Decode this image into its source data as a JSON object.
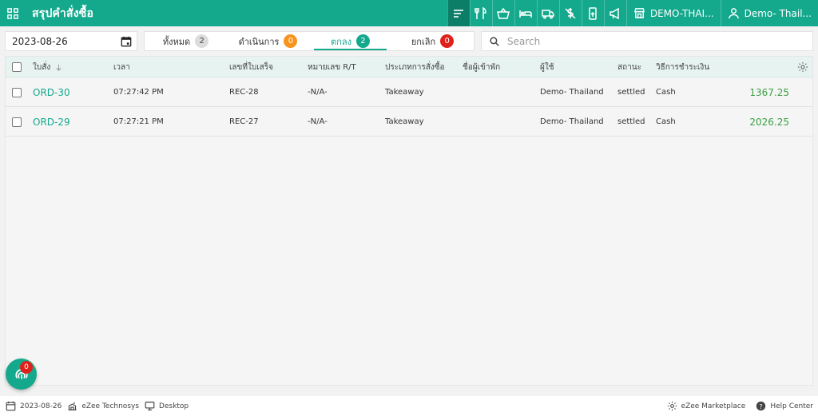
{
  "header": {
    "title": "สรุปคำสั่งซื้อ",
    "outlet": "DEMO-THAI...",
    "user": "Demo- Thail..."
  },
  "toolbar_icons": [
    "orders-icon",
    "dine-in-icon",
    "basket-icon",
    "bed-icon",
    "delivery-truck-icon",
    "no-charge-icon",
    "mobile-order-icon",
    "announcement-icon",
    "store-icon",
    "user-icon"
  ],
  "filters": {
    "date": "2023-08-26",
    "search_placeholder": "Search",
    "tabs": [
      {
        "label": "ทั้งหมด",
        "count": "2",
        "color": "#dcdcdc"
      },
      {
        "label": "ดำเนินการ",
        "count": "0",
        "color": "#f7941d"
      },
      {
        "label": "ตกลง",
        "count": "2",
        "color": "#14a98d"
      },
      {
        "label": "ยกเลิก",
        "count": "0",
        "color": "#e0211b"
      }
    ],
    "active_tab": "ตกลง"
  },
  "table": {
    "columns": [
      "ใบสั่ง",
      "เวลา",
      "เลขที่ใบเสร็จ",
      "หมายเลข R/T",
      "ประเภทการสั่งซื้อ",
      "ชื่อผู้เข้าพัก",
      "ผู้ใช้",
      "สถานะ",
      "วิธีการชำระเงิน"
    ],
    "rows": [
      {
        "order": "ORD-30",
        "time": "07:27:42 PM",
        "receipt": "REC-28",
        "rt": "-N/A-",
        "type": "Takeaway",
        "guest": "",
        "user": "Demo- Thailand",
        "status": "settled",
        "payment": "Cash",
        "amount": "1367.25"
      },
      {
        "order": "ORD-29",
        "time": "07:27:21 PM",
        "receipt": "REC-27",
        "rt": "-N/A-",
        "type": "Takeaway",
        "guest": "",
        "user": "Demo- Thailand",
        "status": "settled",
        "payment": "Cash",
        "amount": "2026.25"
      }
    ]
  },
  "fab": {
    "badge": "0"
  },
  "footer": {
    "date": "2023-08-26",
    "company": "eZee Technosys",
    "device": "Desktop",
    "marketplace": "eZee Marketplace",
    "help": "Help Center"
  },
  "colors": {
    "accent": "#14a98d",
    "amount": "#3aa041",
    "danger": "#e0211b",
    "warning": "#f7941d"
  }
}
